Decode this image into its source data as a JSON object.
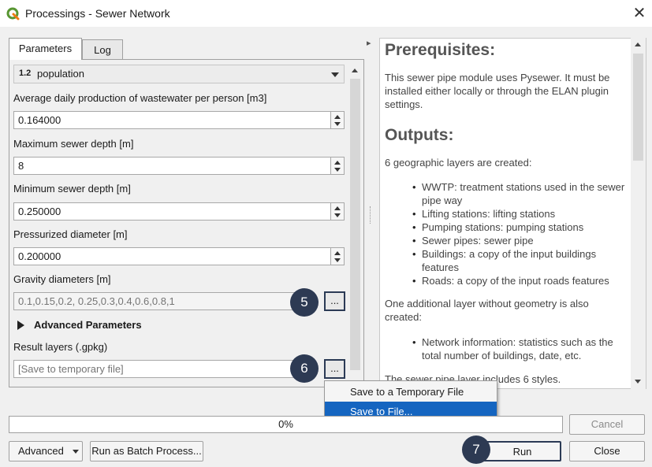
{
  "window": {
    "title": "Processings - Sewer Network",
    "close_glyph": "✕"
  },
  "tabs": [
    {
      "label": "Parameters"
    },
    {
      "label": "Log"
    }
  ],
  "collapse_arrow": "▸",
  "params": {
    "population": {
      "prefix": "1.2",
      "value": "population"
    },
    "wastewater": {
      "label": "Average daily production of wastewater per person [m3]",
      "value": "0.164000"
    },
    "max_depth": {
      "label": "Maximum sewer depth [m]",
      "value": "8"
    },
    "min_depth": {
      "label": "Minimum sewer depth [m]",
      "value": "0.250000"
    },
    "pressurized": {
      "label": "Pressurized diameter [m]",
      "value": "0.200000"
    },
    "gravity": {
      "label": "Gravity diameters [m]",
      "placeholder": "0.1,0.15,0.2, 0.25,0.3,0.4,0.6,0.8,1",
      "button": "..."
    },
    "advanced": {
      "label": "Advanced Parameters"
    },
    "result": {
      "label": "Result layers (.gpkg)",
      "placeholder": "[Save to temporary file]",
      "button": "..."
    }
  },
  "badges": {
    "b5": "5",
    "b6": "6",
    "b7": "7"
  },
  "dropdown": {
    "items": [
      {
        "label": "Save to a Temporary File"
      },
      {
        "label": "Save to File..."
      }
    ]
  },
  "help": {
    "prereq_title": "Prerequisites:",
    "prereq_text": "This sewer pipe module uses Pysewer. It must be installed either locally or through the ELAN plugin settings.",
    "outputs_title": "Outputs:",
    "outputs_intro": "6 geographic layers are created:",
    "outputs_items": [
      "WWTP: treatment stations used in the sewer pipe way",
      "Lifting stations: lifting stations",
      "Pumping stations: pumping stations",
      "Sewer pipes: sewer pipe",
      "Buildings: a copy of the input buildings features",
      "Roads: a copy of the input roads features"
    ],
    "additional_text": "One additional layer without geometry is also created:",
    "additional_items": [
      "Network information: statistics such as the total number of buildings, date, etc."
    ],
    "styles_text": "The sewer pipe layer includes 6 styles."
  },
  "progress": {
    "text": "0%",
    "value": 0
  },
  "buttons": {
    "cancel": "Cancel",
    "advanced": "Advanced",
    "batch": "Run as Batch Process...",
    "run": "Run",
    "close": "Close"
  },
  "colors": {
    "accent": "#2d3a53",
    "selection": "#1565c0",
    "qgis_green": "#589632"
  }
}
